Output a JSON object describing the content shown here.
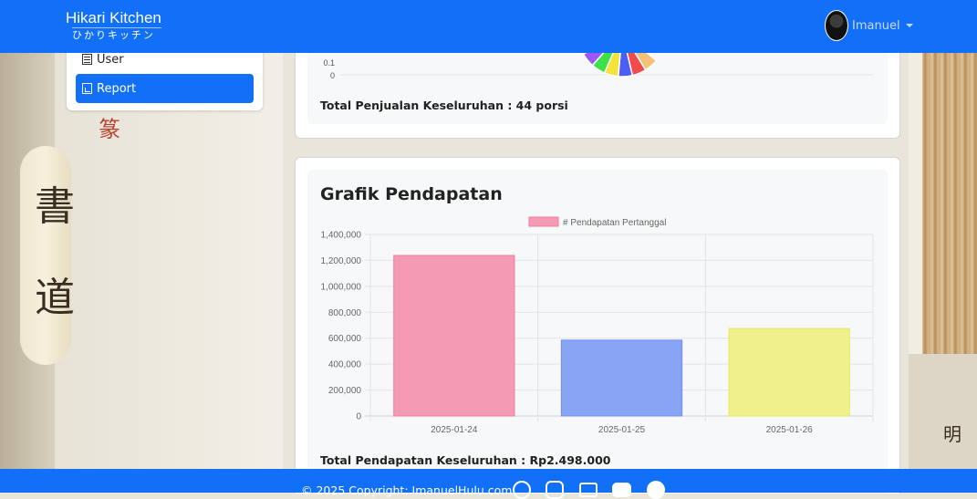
{
  "brand": {
    "title": "Hikari Kitchen",
    "subtitle": "ひかりキッチン"
  },
  "user": {
    "name": "Imanuel"
  },
  "sidebar": {
    "items": [
      {
        "label": "User",
        "icon": "list-icon",
        "active": false
      },
      {
        "label": "Report",
        "icon": "file-icon",
        "active": true
      }
    ]
  },
  "sales_card": {
    "total_label": "Total Penjualan Keseluruhan : 44 porsi",
    "y_ticks": [
      "0.1",
      "0"
    ]
  },
  "income_card": {
    "title": "Grafik Pendapatan",
    "total_label": "Total Pendapatan Keseluruhan : Rp2.498.000"
  },
  "footer": {
    "copyright": "© 2025 Copyright: ImanuelHulu.com"
  },
  "colors": {
    "primary": "#1170f7"
  },
  "chart_data": [
    {
      "type": "pie",
      "partially_visible": true,
      "colors": [
        "#9b59f5",
        "#3ee04a",
        "#f3e33a",
        "#4c5ff3",
        "#f24b4b",
        "#f6c177"
      ]
    },
    {
      "type": "bar",
      "title": "",
      "legend": [
        "# Pendapatan Pertanggal"
      ],
      "legend_position": "top",
      "categories": [
        "2025-01-24",
        "2025-01-25",
        "2025-01-26"
      ],
      "values": [
        1238000,
        585000,
        675000
      ],
      "colors": [
        "#f59ab4",
        "#8aa4f5",
        "#eff28c"
      ],
      "border_colors": [
        "#f27aa0",
        "#6f8ff2",
        "#e5e85c"
      ],
      "ylim": [
        0,
        1400000
      ],
      "y_ticks": [
        "0",
        "200,000",
        "400,000",
        "600,000",
        "800,000",
        "1,000,000",
        "1,200,000",
        "1,400,000"
      ],
      "grid": true
    }
  ]
}
